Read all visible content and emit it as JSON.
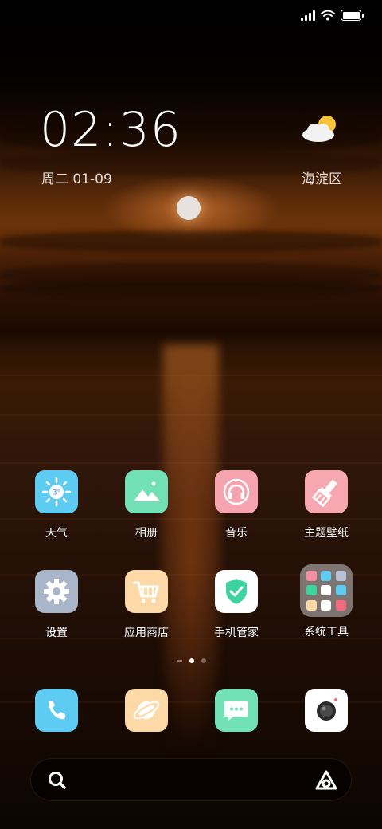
{
  "status": {
    "signal_bars": 4,
    "battery_level": 1.0
  },
  "widget": {
    "time": "02:36",
    "date": "周二 01-09",
    "location": "海淀区",
    "weather_icon": "partly-cloudy-icon"
  },
  "apps": [
    {
      "label": "天气",
      "icon": "weather-app-icon",
      "color": "#5ecbf2",
      "temp": "3°"
    },
    {
      "label": "相册",
      "icon": "gallery-icon",
      "color": "#72e0b5"
    },
    {
      "label": "音乐",
      "icon": "music-icon",
      "color": "#f5a3ae"
    },
    {
      "label": "主题壁纸",
      "icon": "themes-icon",
      "color": "#f7a7b0"
    },
    {
      "label": "设置",
      "icon": "settings-icon",
      "color": "#a9b5c9"
    },
    {
      "label": "应用商店",
      "icon": "app-store-icon",
      "color": "#fcd9a6"
    },
    {
      "label": "手机管家",
      "icon": "security-icon",
      "color": "#ffffff"
    },
    {
      "label": "系统工具",
      "icon": "system-tools-folder-icon",
      "color": "#c8c8c8"
    }
  ],
  "page_indicator": {
    "pages": 2,
    "active": 0
  },
  "dock": [
    {
      "icon": "phone-icon",
      "color": "#5ecbf2"
    },
    {
      "icon": "browser-icon",
      "color": "#fcd9a6"
    },
    {
      "icon": "messages-icon",
      "color": "#72e0b5"
    },
    {
      "icon": "camera-icon",
      "color": "#ffffff"
    }
  ],
  "searchbar": {
    "left_icon": "search-icon",
    "right_icon": "assistant-icon"
  }
}
